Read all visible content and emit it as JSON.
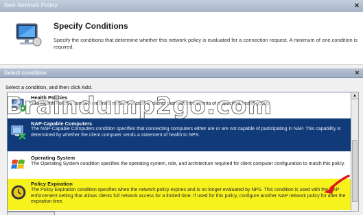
{
  "window": {
    "title": "New Network Policy"
  },
  "header": {
    "title": "Specify Conditions",
    "description": "Specify the conditions that determine whether this network policy is evaluated for a connection request. A minimum of one condition is required."
  },
  "dialog": {
    "title": "Select condition",
    "instruction": "Select a condition, and then click Add.",
    "items": [
      {
        "name": "Health Policies",
        "description": "The Health Policies condition restricts network access to clients that meet the criteria of a specified health policy.",
        "icon": "health-policy-icon",
        "state": "normal"
      },
      {
        "name": "NAP-Capable Computers",
        "description": "The NAP-Capable Computers condition specifies that connecting computers either are or are not capable of participating in NAP. This capability is determined by whether the client computer sends a statement of health to NPS.",
        "icon": "nap-computer-icon",
        "state": "selected"
      },
      {
        "name": "Operating System",
        "description": "The Operating System condition specifies the operating system, role, and architecture required for client computer configuration to match this policy.",
        "icon": "windows-logo-icon",
        "state": "normal"
      },
      {
        "name": "Policy Expiration",
        "description": "The Policy Expiration condition specifies when the network policy expires and is no longer evaluated by NPS. This condition is used with the NAP enforcement setting that allows clients full network access for a limited time. If used for this policy, configure another NAP network policy for after the expiration time.",
        "icon": "clock-icon",
        "state": "highlighted"
      }
    ]
  },
  "watermark": "Braindump2go.com",
  "colors": {
    "selected": "#103a78",
    "highlight": "#f7f21c",
    "arrow": "#e01818"
  }
}
